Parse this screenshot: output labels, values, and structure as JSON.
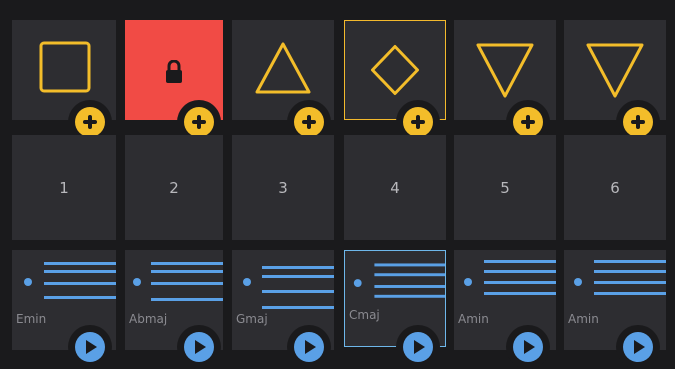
{
  "steps": [
    {
      "shape": "square",
      "number": "1",
      "chord": "Emin",
      "locked": false,
      "selected": false
    },
    {
      "shape": "locked",
      "number": "2",
      "chord": "Abmaj",
      "locked": true,
      "selected": false
    },
    {
      "shape": "triangle-up",
      "number": "3",
      "chord": "Gmaj",
      "locked": false,
      "selected": false
    },
    {
      "shape": "diamond",
      "number": "4",
      "chord": "Cmaj",
      "locked": false,
      "selected": true
    },
    {
      "shape": "triangle-down",
      "number": "5",
      "chord": "Amin",
      "locked": false,
      "selected": false
    },
    {
      "shape": "triangle-down",
      "number": "6",
      "chord": "Amin",
      "locked": false,
      "selected": false
    }
  ],
  "colors": {
    "background": "#1a1a1c",
    "cell": "#2d2d31",
    "accent_yellow": "#f3bd2a",
    "accent_blue": "#5aa0e6",
    "locked_red": "#f14b45",
    "text": "#b8b8bc"
  },
  "icons": {
    "add": "plus-circle-icon",
    "play": "play-circle-icon",
    "lock": "lock-icon",
    "chord": "chord-lines-icon"
  }
}
